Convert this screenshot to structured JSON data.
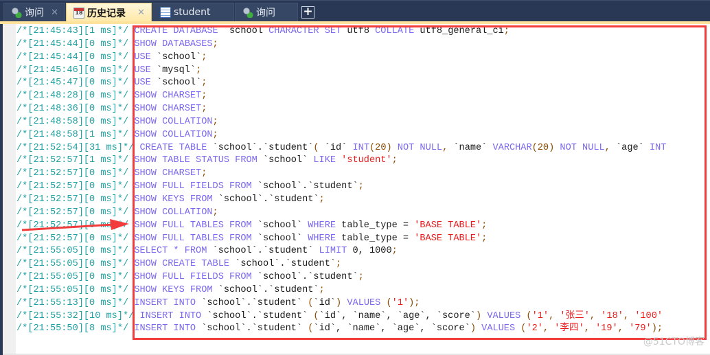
{
  "tabs": [
    {
      "label": "询问",
      "icon": "query-icon",
      "active": false,
      "closable": true
    },
    {
      "label": "历史记录",
      "icon": "calendar-icon",
      "active": true,
      "closable": true,
      "icon_text": "18"
    },
    {
      "label": "student",
      "icon": "table-icon",
      "active": false,
      "closable": false
    },
    {
      "label": "询问",
      "icon": "query-icon",
      "active": false,
      "closable": false
    }
  ],
  "add_tab_label": "+",
  "close_glyph": "✕",
  "history": [
    {
      "prefix": "/*[21:45:43][1 ms]*/",
      "tokens": [
        [
          "kw",
          "CREATE DATABASE "
        ],
        [
          "id",
          "`school`"
        ],
        [
          "kw",
          "CHARACTER SET "
        ],
        [
          "id",
          "utf8 "
        ],
        [
          "kw",
          "COLLATE "
        ],
        [
          "id",
          "utf8_general_ci"
        ],
        [
          "pn",
          ";"
        ]
      ]
    },
    {
      "prefix": "/*[21:45:44][0 ms]*/",
      "tokens": [
        [
          "kw",
          "SHOW DATABASES"
        ],
        [
          "pn",
          ";"
        ]
      ]
    },
    {
      "prefix": "/*[21:45:44][0 ms]*/",
      "tokens": [
        [
          "kw",
          "USE "
        ],
        [
          "id",
          "`school`"
        ],
        [
          "pn",
          ";"
        ]
      ]
    },
    {
      "prefix": "/*[21:45:46][0 ms]*/",
      "tokens": [
        [
          "kw",
          "USE "
        ],
        [
          "id",
          "`mysql`"
        ],
        [
          "pn",
          ";"
        ]
      ]
    },
    {
      "prefix": "/*[21:45:47][0 ms]*/",
      "tokens": [
        [
          "kw",
          "USE "
        ],
        [
          "id",
          "`school`"
        ],
        [
          "pn",
          ";"
        ]
      ]
    },
    {
      "prefix": "/*[21:48:28][0 ms]*/",
      "tokens": [
        [
          "kw",
          "SHOW CHARSET"
        ],
        [
          "pn",
          ";"
        ]
      ]
    },
    {
      "prefix": "/*[21:48:36][0 ms]*/",
      "tokens": [
        [
          "kw",
          "SHOW CHARSET"
        ],
        [
          "pn",
          ";"
        ]
      ]
    },
    {
      "prefix": "/*[21:48:58][0 ms]*/",
      "tokens": [
        [
          "kw",
          "SHOW COLLATION"
        ],
        [
          "pn",
          ";"
        ]
      ]
    },
    {
      "prefix": "/*[21:48:58][1 ms]*/",
      "tokens": [
        [
          "kw",
          "SHOW COLLATION"
        ],
        [
          "pn",
          ";"
        ]
      ]
    },
    {
      "prefix": "/*[21:52:54][31 ms]*/",
      "tokens": [
        [
          "kw",
          "CREATE TABLE "
        ],
        [
          "id",
          "`school`.`student`"
        ],
        [
          "pn",
          "( "
        ],
        [
          "id",
          "`id` "
        ],
        [
          "kw",
          "INT"
        ],
        [
          "pn",
          "(20) "
        ],
        [
          "kw",
          "NOT NULL"
        ],
        [
          "pn",
          ", "
        ],
        [
          "id",
          "`name` "
        ],
        [
          "kw",
          "VARCHAR"
        ],
        [
          "pn",
          "(20) "
        ],
        [
          "kw",
          "NOT NULL"
        ],
        [
          "pn",
          ", "
        ],
        [
          "id",
          "`age` "
        ],
        [
          "kw",
          "INT"
        ]
      ]
    },
    {
      "prefix": "/*[21:52:57][1 ms]*/",
      "tokens": [
        [
          "kw",
          "SHOW TABLE STATUS FROM "
        ],
        [
          "id",
          "`school` "
        ],
        [
          "kw",
          "LIKE "
        ],
        [
          "str",
          "'student'"
        ],
        [
          "pn",
          ";"
        ]
      ]
    },
    {
      "prefix": "/*[21:52:57][0 ms]*/",
      "tokens": [
        [
          "kw",
          "SHOW CHARSET"
        ],
        [
          "pn",
          ";"
        ]
      ]
    },
    {
      "prefix": "/*[21:52:57][0 ms]*/",
      "tokens": [
        [
          "kw",
          "SHOW FULL FIELDS FROM "
        ],
        [
          "id",
          "`school`.`student`"
        ],
        [
          "pn",
          ";"
        ]
      ]
    },
    {
      "prefix": "/*[21:52:57][0 ms]*/",
      "tokens": [
        [
          "kw",
          "SHOW KEYS FROM "
        ],
        [
          "id",
          "`school`.`student`"
        ],
        [
          "pn",
          ";"
        ]
      ]
    },
    {
      "prefix": "/*[21:52:57][0 ms]*/",
      "tokens": [
        [
          "kw",
          "SHOW COLLATION"
        ],
        [
          "pn",
          ";"
        ]
      ]
    },
    {
      "prefix": "/*[21:52:57][0 ms]*/",
      "tokens": [
        [
          "kw",
          "SHOW FULL TABLES FROM "
        ],
        [
          "id",
          "`school` "
        ],
        [
          "kw",
          "WHERE "
        ],
        [
          "id",
          "table_type = "
        ],
        [
          "str",
          "'BASE TABLE'"
        ],
        [
          "pn",
          ";"
        ]
      ]
    },
    {
      "prefix": "/*[21:52:57][0 ms]*/",
      "tokens": [
        [
          "kw",
          "SHOW FULL TABLES FROM "
        ],
        [
          "id",
          "`school` "
        ],
        [
          "kw",
          "WHERE "
        ],
        [
          "id",
          "table_type = "
        ],
        [
          "str",
          "'BASE TABLE'"
        ],
        [
          "pn",
          ";"
        ]
      ]
    },
    {
      "prefix": "/*[21:55:05][0 ms]*/",
      "tokens": [
        [
          "kw",
          "SELECT * FROM "
        ],
        [
          "id",
          "`school`.`student` "
        ],
        [
          "kw",
          "LIMIT "
        ],
        [
          "id",
          "0, 1000"
        ],
        [
          "pn",
          ";"
        ]
      ]
    },
    {
      "prefix": "/*[21:55:05][0 ms]*/",
      "tokens": [
        [
          "kw",
          "SHOW CREATE TABLE "
        ],
        [
          "id",
          "`school`.`student`"
        ],
        [
          "pn",
          ";"
        ]
      ]
    },
    {
      "prefix": "/*[21:55:05][0 ms]*/",
      "tokens": [
        [
          "kw",
          "SHOW FULL FIELDS FROM "
        ],
        [
          "id",
          "`school`.`student`"
        ],
        [
          "pn",
          ";"
        ]
      ]
    },
    {
      "prefix": "/*[21:55:05][0 ms]*/",
      "tokens": [
        [
          "kw",
          "SHOW KEYS FROM "
        ],
        [
          "id",
          "`school`.`student`"
        ],
        [
          "pn",
          ";"
        ]
      ]
    },
    {
      "prefix": "/*[21:55:13][0 ms]*/",
      "tokens": [
        [
          "kw",
          "INSERT INTO "
        ],
        [
          "id",
          "`school`.`student` "
        ],
        [
          "pn",
          "("
        ],
        [
          "id",
          "`id`"
        ],
        [
          "pn",
          ") "
        ],
        [
          "kw",
          "VALUES "
        ],
        [
          "pn",
          "("
        ],
        [
          "str",
          "'1'"
        ],
        [
          "pn",
          ");"
        ]
      ]
    },
    {
      "prefix": "/*[21:55:32][10 ms]*/",
      "tokens": [
        [
          "kw",
          "INSERT INTO "
        ],
        [
          "id",
          "`school`.`student` "
        ],
        [
          "pn",
          "("
        ],
        [
          "id",
          "`id`, `name`, `age`, `score`"
        ],
        [
          "pn",
          ") "
        ],
        [
          "kw",
          "VALUES "
        ],
        [
          "pn",
          "("
        ],
        [
          "str",
          "'1'"
        ],
        [
          "pn",
          ", "
        ],
        [
          "str",
          "'张三'"
        ],
        [
          "pn",
          ", "
        ],
        [
          "str",
          "'18'"
        ],
        [
          "pn",
          ", "
        ],
        [
          "str",
          "'100'"
        ]
      ]
    },
    {
      "prefix": "/*[21:55:50][8 ms]*/",
      "tokens": [
        [
          "kw",
          "INSERT INTO "
        ],
        [
          "id",
          "`school`.`student` "
        ],
        [
          "pn",
          "("
        ],
        [
          "id",
          "`id`, `name`, `age`, `score`"
        ],
        [
          "pn",
          ") "
        ],
        [
          "kw",
          "VALUES "
        ],
        [
          "pn",
          "("
        ],
        [
          "str",
          "'2'"
        ],
        [
          "pn",
          ", "
        ],
        [
          "str",
          "'李四'"
        ],
        [
          "pn",
          ", "
        ],
        [
          "str",
          "'19'"
        ],
        [
          "pn",
          ", "
        ],
        [
          "str",
          "'79'"
        ],
        [
          "pn",
          ");"
        ]
      ]
    }
  ],
  "annotation": {
    "box_color": "#f23b3b",
    "arrow_color": "#f23b3b"
  },
  "watermark": "@51CTO博客"
}
